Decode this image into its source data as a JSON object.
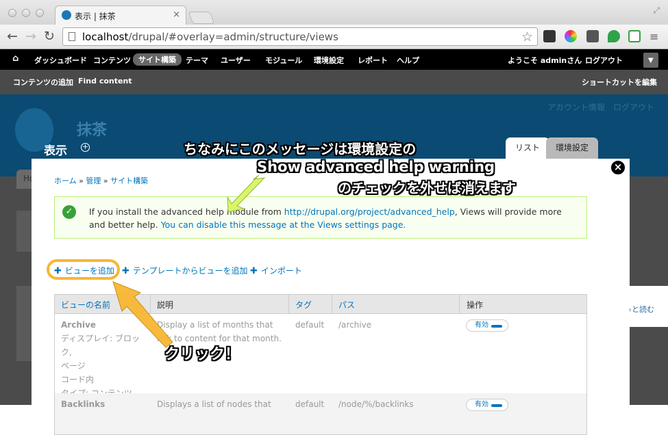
{
  "browser": {
    "tab_title": "表示 | 抹茶",
    "tab_close": "×",
    "url_host": "localhost",
    "url_path": "/drupal/#overlay=admin/structure/views",
    "star": "☆",
    "back": "←",
    "forward": "→",
    "reload": "↻",
    "extension_colors": [
      "#333333",
      "#e8a12c",
      "#555555",
      "#2fa34a",
      "#3c9f40"
    ]
  },
  "admin_menu": {
    "home": "⌂",
    "items": [
      "ダッシュボード",
      "コンテンツ",
      "サイト構築",
      "テーマ",
      "ユーザー",
      "モジュール",
      "環境設定",
      "レポート",
      "ヘルプ"
    ],
    "active_index": 2,
    "welcome": "ようこそ adminさん",
    "logout": "ログアウト",
    "dropdown": "▼"
  },
  "shortcuts": {
    "add_content": "コンテンツの追加",
    "find_content": "Find content",
    "edit_shortcuts": "ショートカットを編集"
  },
  "site": {
    "name": "抹茶",
    "account_link": "アカウント情報",
    "logout_link": "ログアウト",
    "page_title": "表示",
    "page_title_plus": "+",
    "tabs": [
      "リスト",
      "環境設定"
    ],
    "bg_tab_fragment": "Ho",
    "read_more": "もっと読む"
  },
  "overlay": {
    "close": "×",
    "breadcrumb": [
      "ホーム",
      "管理",
      "サイト構築"
    ],
    "breadcrumb_sep": "»",
    "message": {
      "icon": "✓",
      "text_prefix": "If you install the advanced help module from ",
      "link": "http://drupal.org/project/advanced_help",
      "text_mid": ", Views will provide more and better help. ",
      "disable_link": "You can disable this message at the Views settings page."
    },
    "actions": {
      "plus": "✚",
      "add_view": "ビューを追加",
      "add_from_template": "テンプレートからビューを追加",
      "import": "インポート"
    },
    "table": {
      "headers": [
        "ビューの名前",
        "説明",
        "タグ",
        "パス",
        "操作"
      ],
      "rows": [
        {
          "name": "Archive",
          "meta": [
            "ディスプレイ: ブロック,",
            "ページ",
            "コード内",
            "タイプ: コンテンツ"
          ],
          "description": "Display a list of months that link to content for that month.",
          "tag": "default",
          "path": "/archive",
          "operation": "有効"
        },
        {
          "name": "Backlinks",
          "description": "Displays a list of nodes that",
          "tag": "default",
          "path": "/node/%/backlinks",
          "operation": "有効"
        }
      ]
    }
  },
  "annotations": {
    "line1": "ちなみにこのメッセージは環境設定の",
    "line2": "Show advanced help warning",
    "line3": "のチェックを外せば消えます",
    "click": "クリック！",
    "arrow_color": "#d8f56b",
    "click_arrow_color": "#f7b733"
  }
}
